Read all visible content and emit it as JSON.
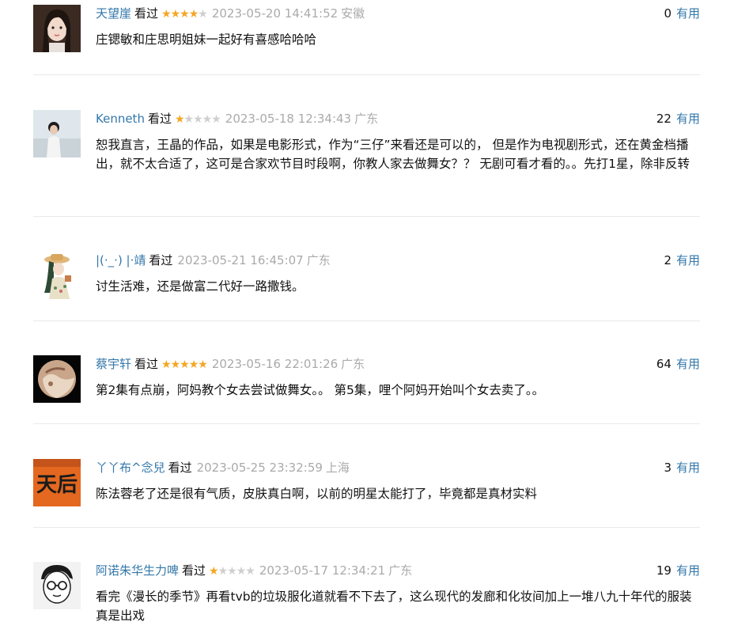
{
  "comments": [
    {
      "user": "天望崖",
      "watched": "看过",
      "rating": 4,
      "time": "2023-05-20 14:41:52",
      "location": "安徽",
      "votes": "0",
      "useful": "有用",
      "content": "庄锶敏和庄思明姐妹一起好有喜感哈哈哈",
      "avatar": "avatar-woman-portrait"
    },
    {
      "user": "Kenneth",
      "watched": "看过",
      "rating": 1,
      "time": "2023-05-18 12:34:43",
      "location": "广东",
      "votes": "22",
      "useful": "有用",
      "content": "恕我直言，王晶的作品，如果是电影形式，作为“三仔”来看还是可以的， 但是作为电视剧形式，还在黄金档播出，就不太合适了，这可是合家欢节目时段啊，你教人家去做舞女？？ 无剧可看才看的。。先打1星，除非反转",
      "avatar": "avatar-man-beach"
    },
    {
      "user": "|(·_·) |·靖",
      "watched": "看过",
      "rating": 0,
      "time": "2023-05-21 16:45:07",
      "location": "广东",
      "votes": "2",
      "useful": "有用",
      "content": "讨生活难，还是做富二代好一路撒钱。",
      "avatar": "avatar-illustration-hat"
    },
    {
      "user": "蔡宇轩",
      "watched": "看过",
      "rating": 5,
      "time": "2023-05-16 22:01:26",
      "location": "广东",
      "votes": "64",
      "useful": "有用",
      "content": "第2集有点崩，阿妈教个女去尝试做舞女。。 第5集，哩个阿妈开始叫个女去卖了。。",
      "avatar": "avatar-planet"
    },
    {
      "user": "丫丫布^念兒",
      "watched": "看过",
      "rating": 0,
      "time": "2023-05-25 23:32:59",
      "location": "上海",
      "votes": "3",
      "useful": "有用",
      "content": "陈法蓉老了还是很有气质，皮肤真白啊，以前的明星太能打了，毕竟都是真材实料",
      "avatar": "avatar-orange-sign",
      "avatar_text": "天后"
    },
    {
      "user": "阿诺朱华生力啤",
      "watched": "看过",
      "rating": 1,
      "time": "2023-05-17 12:34:21",
      "location": "广东",
      "votes": "19",
      "useful": "有用",
      "content": "看完《漫长的季节》再看tvb的垃圾服化道就看不下去了，这么现代的发廊和化妆间加上一堆八九十年代的服装真是出戏",
      "avatar": "avatar-cartoon-glasses"
    }
  ],
  "colors": {
    "link": "#3377aa",
    "star_on": "#f5a623",
    "star_off": "#cfcfcf",
    "meta": "#aaaaaa"
  }
}
